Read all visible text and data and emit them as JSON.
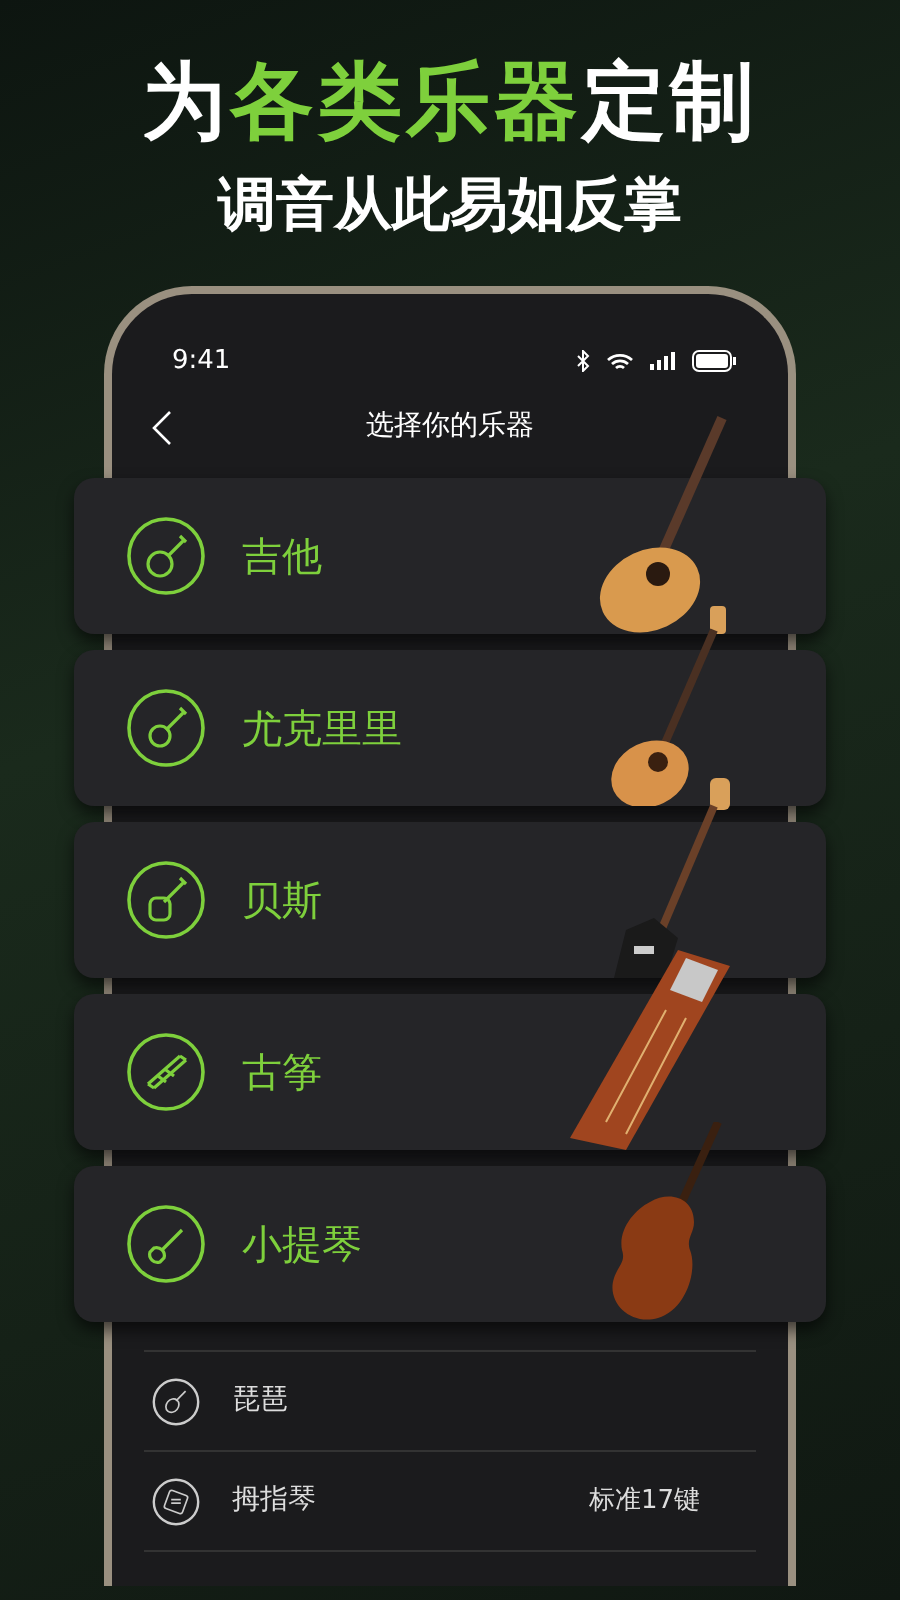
{
  "headline": {
    "parts": [
      {
        "text": "为",
        "highlight": false
      },
      {
        "text": "各类乐器",
        "highlight": true
      },
      {
        "text": "定制",
        "highlight": false
      }
    ]
  },
  "subtitle": "调音从此易如反掌",
  "status_bar": {
    "time": "9:41"
  },
  "nav": {
    "title": "选择你的乐器"
  },
  "featured": [
    {
      "name": "吉他",
      "kind": "guitar"
    },
    {
      "name": "尤克里里",
      "kind": "ukulele"
    },
    {
      "name": "贝斯",
      "kind": "bass"
    },
    {
      "name": "古筝",
      "kind": "guzheng"
    },
    {
      "name": "小提琴",
      "kind": "violin"
    }
  ],
  "list": [
    {
      "name": "琵琶",
      "kind": "pipa"
    },
    {
      "name": "拇指琴",
      "kind": "kalimba",
      "value": "标准17键"
    }
  ]
}
